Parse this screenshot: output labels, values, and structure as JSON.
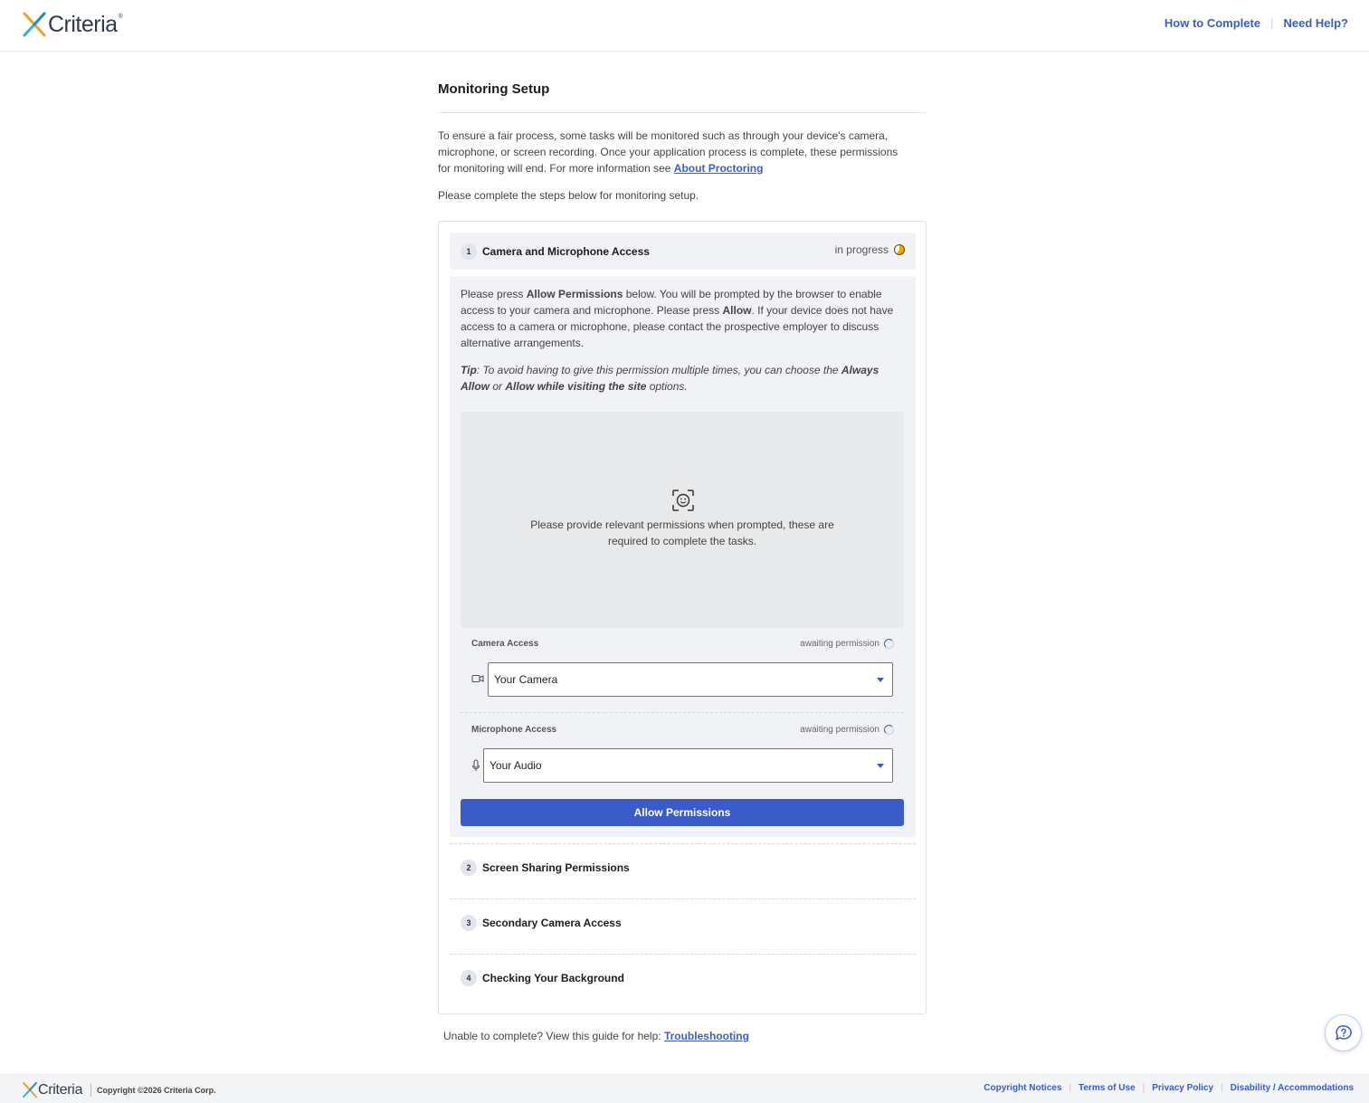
{
  "header": {
    "brand": "Criteria",
    "links": [
      "How to Complete",
      "Need Help?"
    ]
  },
  "page": {
    "title": "Monitoring Setup",
    "intro": "To ensure a fair process, some tasks will be monitored such as through your device's camera, microphone, or screen recording. Once your application process is complete, these permissions for monitoring will end. For more information see ",
    "intro_link": "About Proctoring",
    "intro2": "Please complete the steps below for monitoring setup."
  },
  "steps": [
    {
      "number": "1",
      "title": "Camera and Microphone Access",
      "status": "in progress"
    },
    {
      "number": "2",
      "title": "Screen Sharing Permissions"
    },
    {
      "number": "3",
      "title": "Secondary Camera Access"
    },
    {
      "number": "4",
      "title": "Checking Your Background"
    }
  ],
  "panel": {
    "p1_a": "Please press ",
    "p1_b": "Allow Permissions",
    "p1_c": " below. You will be prompted by the browser to enable access to your camera and microphone. Please press ",
    "p1_d": "Allow",
    "p1_e": ". If your device does not have access to a camera or microphone, please contact the prospective employer to discuss alternative arrangements.",
    "tip_a": "Tip",
    "tip_b": ": To avoid having to give this permission multiple times, you can choose the ",
    "tip_c": "Always Allow",
    "tip_d": " or ",
    "tip_e": "Allow while visiting the site",
    "tip_f": " options.",
    "preview_text": "Please provide relevant permissions when prompted, these are required to complete the tasks.",
    "camera_label": "Camera Access",
    "camera_status": "awaiting permission",
    "camera_value": "Your Camera",
    "mic_label": "Microphone Access",
    "mic_status": "awaiting permission",
    "mic_value": "Your Audio",
    "allow_button": "Allow Permissions"
  },
  "help": {
    "text": "Unable to complete? View this guide for help: ",
    "link": "Troubleshooting"
  },
  "footer": {
    "brand": "Criteria",
    "copyright": "Copyright ©2026 Criteria Corp.",
    "links": [
      "Copyright Notices",
      "Terms of Use",
      "Privacy Policy",
      "Disability / Accommodations"
    ]
  },
  "colors": {
    "accent": "#3b5bc9",
    "progress": "#f1a700"
  }
}
